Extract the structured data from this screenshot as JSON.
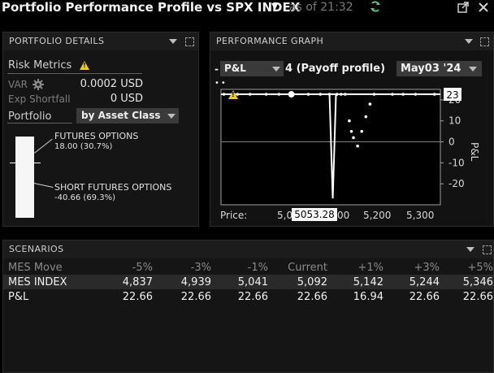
{
  "window": {
    "title": "Portfolio Performance Profile vs SPX INDEX",
    "as_of": "as of 21:32"
  },
  "portfolio_details": {
    "header": "PORTFOLIO DETAILS",
    "risk_metrics_label": "Risk Metrics",
    "var_label": "VAR",
    "var_value": "0.0002 USD",
    "exp_shortfall_label": "Exp Shortfall",
    "exp_shortfall_value": "0 USD",
    "portfolio_label": "Portfolio",
    "group_by": "by Asset Class",
    "allocations": [
      {
        "name": "FUTURES OPTIONS",
        "value": "18.00 (30.7%)",
        "share": 0.307
      },
      {
        "name": "SHORT FUTURES OPTIONS",
        "value": "-40.66 (69.3%)",
        "share": 0.693
      }
    ]
  },
  "performance_graph": {
    "header": "PERFORMANCE GRAPH",
    "metric": "P&L",
    "profile_label": "4 (Payoff profile)",
    "expiry": "May03 '24",
    "price_label": "Price:",
    "cursor_price": "5053.28",
    "current_value_flag": "23",
    "x_ticks": [
      "5,0",
      "00",
      "5,200",
      "5,300"
    ],
    "y_ticks": [
      "20",
      "10",
      "0",
      "-10",
      "-20"
    ],
    "y_axis_label": "P&L"
  },
  "chart_data": {
    "type": "scatter",
    "x": [
      4837,
      4870,
      4900,
      4939,
      4970,
      5000,
      5041,
      5070,
      5092,
      5100,
      5110,
      5120,
      5130,
      5140,
      5145,
      5150,
      5160,
      5170,
      5180,
      5190,
      5200,
      5244,
      5270,
      5300,
      5346
    ],
    "y": [
      22.66,
      22.66,
      22.66,
      22.66,
      22.66,
      22.66,
      22.66,
      22.66,
      22.66,
      -27,
      22.66,
      22.66,
      22.66,
      10,
      5,
      2,
      -2,
      5,
      12,
      18,
      22.66,
      22.66,
      22.66,
      22.66,
      22.66
    ],
    "xlim": [
      4830,
      5360
    ],
    "ylim": [
      -30,
      25
    ],
    "xlabel": "Price:",
    "ylabel": "P&L",
    "zero_line": 0,
    "grid": false
  },
  "scenarios": {
    "header": "SCENARIOS",
    "columns": [
      "MES Move",
      "-5%",
      "-3%",
      "-1%",
      "Current",
      "+1%",
      "+3%",
      "+5%"
    ],
    "rows": [
      {
        "label": "MES INDEX",
        "values": [
          "4,837",
          "4,939",
          "5,041",
          "5,092",
          "5,142",
          "5,244",
          "5,346"
        ]
      },
      {
        "label": "P&L",
        "values": [
          "22.66",
          "22.66",
          "22.66",
          "22.66",
          "16.94",
          "22.66",
          "22.66"
        ]
      }
    ]
  },
  "colors": {
    "warning": "#f0d000",
    "refresh_icon": "#5fbf6f"
  }
}
